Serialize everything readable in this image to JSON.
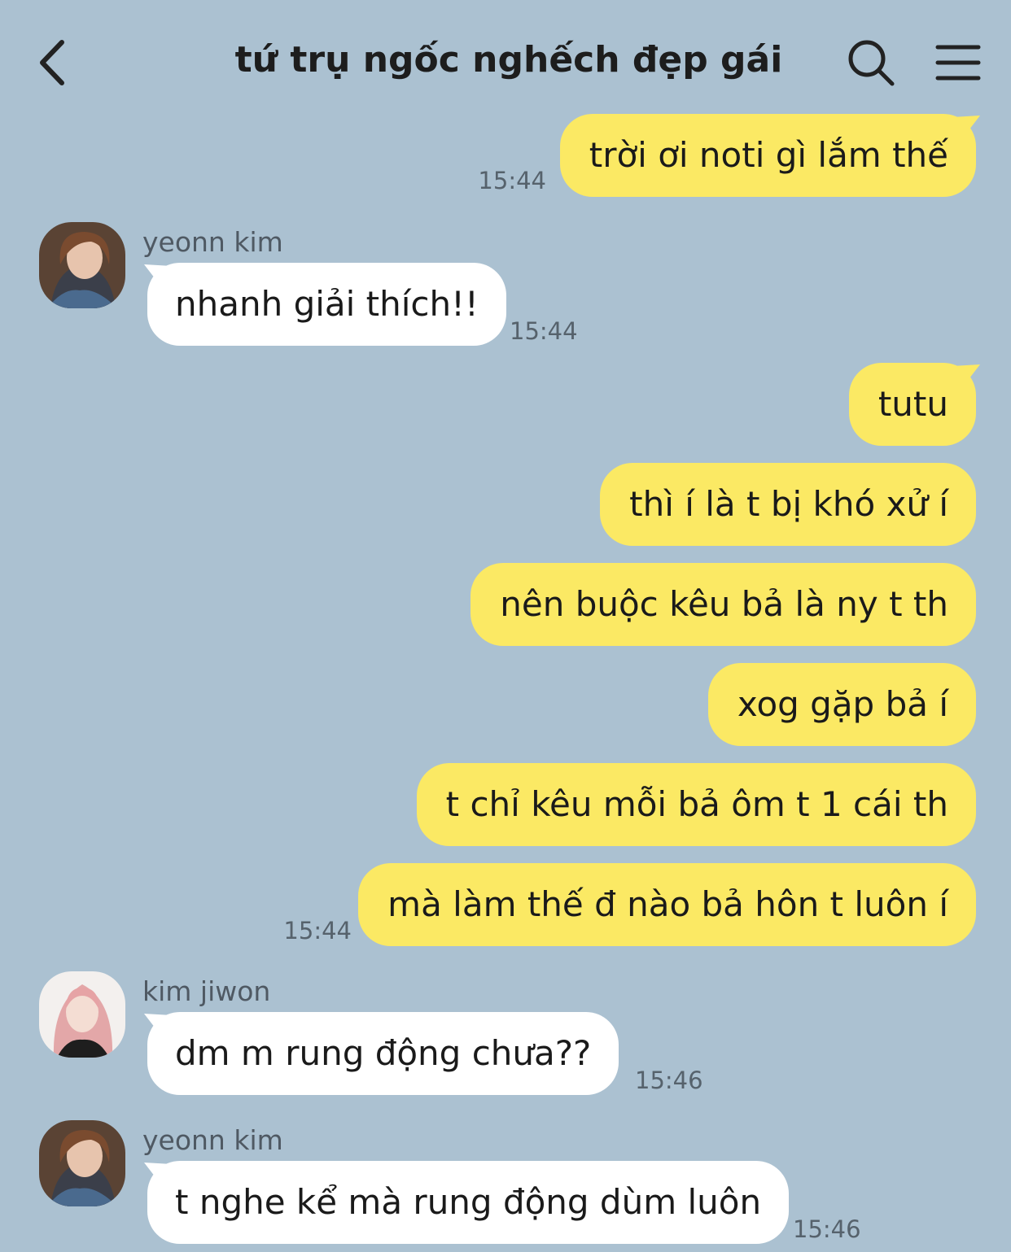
{
  "header": {
    "title": "tứ trụ ngốc nghếch đẹp gái",
    "back_icon": "chevron-left-icon",
    "search_icon": "search-icon",
    "menu_icon": "hamburger-menu-icon"
  },
  "colors": {
    "background": "#abc1d1",
    "outgoing_bubble": "#fbe964",
    "incoming_bubble": "#ffffff"
  },
  "messages": [
    {
      "direction": "outgoing",
      "text": "trời ơi noti gì lắm thế",
      "time": "15:44"
    },
    {
      "direction": "incoming",
      "sender": "yeonn kim",
      "text": "nhanh giải thích!!",
      "time": "15:44"
    },
    {
      "direction": "outgoing",
      "text": "tutu"
    },
    {
      "direction": "outgoing",
      "text": "thì í là t bị khó xử í"
    },
    {
      "direction": "outgoing",
      "text": "nên buộc kêu bả là ny t th"
    },
    {
      "direction": "outgoing",
      "text": "xog gặp bả í"
    },
    {
      "direction": "outgoing",
      "text": "t chỉ kêu mỗi bả ôm t 1 cái th"
    },
    {
      "direction": "outgoing",
      "text": "mà làm thế đ nào bả hôn t luôn í",
      "time": "15:44"
    },
    {
      "direction": "incoming",
      "sender": "kim jiwon",
      "text": "dm m rung động chưa??",
      "time": "15:46"
    },
    {
      "direction": "incoming",
      "sender": "yeonn kim",
      "text": "t nghe kể mà rung động dùm luôn",
      "time": "15:46"
    }
  ]
}
